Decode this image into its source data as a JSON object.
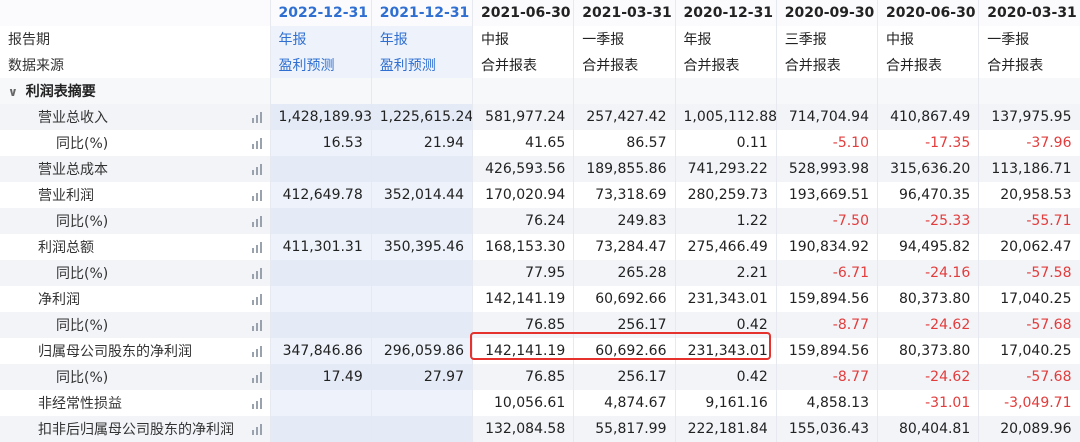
{
  "columns": [
    "2022-12-31",
    "2021-12-31",
    "2021-06-30",
    "2021-03-31",
    "2020-12-31",
    "2020-09-30",
    "2020-06-30",
    "2020-03-31"
  ],
  "report_period": {
    "label": "报告期",
    "values": [
      "年报",
      "年报",
      "中报",
      "一季报",
      "年报",
      "三季报",
      "中报",
      "一季报"
    ]
  },
  "data_source": {
    "label": "数据来源",
    "values": [
      "盈利预测",
      "盈利预测",
      "合并报表",
      "合并报表",
      "合并报表",
      "合并报表",
      "合并报表",
      "合并报表"
    ]
  },
  "section": {
    "label": "利润表摘要"
  },
  "rows": [
    {
      "label": "营业总收入",
      "values": [
        "1,428,189.93",
        "1,225,615.24",
        "581,977.24",
        "257,427.42",
        "1,005,112.88",
        "714,704.94",
        "410,867.49",
        "137,975.95"
      ]
    },
    {
      "label": "同比(%)",
      "values": [
        "16.53",
        "21.94",
        "41.65",
        "86.57",
        "0.11",
        "-5.10",
        "-17.35",
        "-37.96"
      ]
    },
    {
      "label": "营业总成本",
      "values": [
        "",
        "",
        "426,593.56",
        "189,855.86",
        "741,293.22",
        "528,993.98",
        "315,636.20",
        "113,186.71"
      ]
    },
    {
      "label": "营业利润",
      "values": [
        "412,649.78",
        "352,014.44",
        "170,020.94",
        "73,318.69",
        "280,259.73",
        "193,669.51",
        "96,470.35",
        "20,958.53"
      ]
    },
    {
      "label": "同比(%)",
      "values": [
        "",
        "",
        "76.24",
        "249.83",
        "1.22",
        "-7.50",
        "-25.33",
        "-55.71"
      ]
    },
    {
      "label": "利润总额",
      "values": [
        "411,301.31",
        "350,395.46",
        "168,153.30",
        "73,284.47",
        "275,466.49",
        "190,834.92",
        "94,495.82",
        "20,062.47"
      ]
    },
    {
      "label": "同比(%)",
      "values": [
        "",
        "",
        "77.95",
        "265.28",
        "2.21",
        "-6.71",
        "-24.16",
        "-57.58"
      ]
    },
    {
      "label": "净利润",
      "values": [
        "",
        "",
        "142,141.19",
        "60,692.66",
        "231,343.01",
        "159,894.56",
        "80,373.80",
        "17,040.25"
      ]
    },
    {
      "label": "同比(%)",
      "values": [
        "",
        "",
        "76.85",
        "256.17",
        "0.42",
        "-8.77",
        "-24.62",
        "-57.68"
      ]
    },
    {
      "label": "归属母公司股东的净利润",
      "values": [
        "347,846.86",
        "296,059.86",
        "142,141.19",
        "60,692.66",
        "231,343.01",
        "159,894.56",
        "80,373.80",
        "17,040.25"
      ]
    },
    {
      "label": "同比(%)",
      "values": [
        "17.49",
        "27.97",
        "76.85",
        "256.17",
        "0.42",
        "-8.77",
        "-24.62",
        "-57.68"
      ]
    },
    {
      "label": "非经常性损益",
      "values": [
        "",
        "",
        "10,056.61",
        "4,874.67",
        "9,161.16",
        "4,858.13",
        "-31.01",
        "-3,049.71"
      ]
    },
    {
      "label": "扣非后归属母公司股东的净利润",
      "values": [
        "",
        "",
        "132,084.58",
        "55,817.99",
        "222,181.84",
        "155,036.43",
        "80,404.81",
        "20,089.96"
      ]
    }
  ],
  "colors": {
    "forecast_blue": "#2f6fd1",
    "negative_red": "#e23c3c",
    "highlight_border": "#e5322d"
  },
  "icons": {
    "section_toggle": "chevron-down-icon",
    "row_chart": "bar-chart-icon"
  }
}
